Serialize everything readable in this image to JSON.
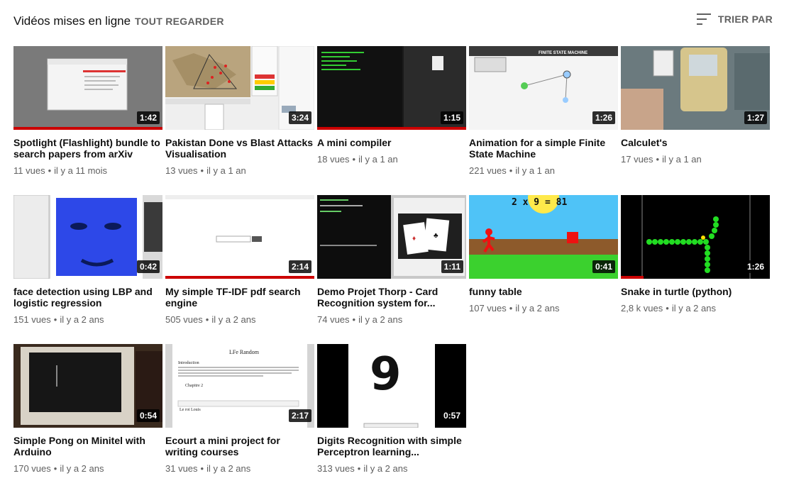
{
  "header": {
    "title": "Vidéos mises en ligne",
    "watch_all": "TOUT REGARDER",
    "sort": {
      "label": "TRIER PAR",
      "icon": "sort-icon"
    }
  },
  "videos": [
    {
      "title": "Spotlight (Flashlight) bundle to search papers from arXiv",
      "duration": "1:42",
      "views": "11 vues",
      "age": "il y a 11 mois",
      "watched": 1.0
    },
    {
      "title": "Pakistan Done vs Blast Attacks Visualisation",
      "duration": "3:24",
      "views": "13 vues",
      "age": "il y a 1 an",
      "watched": 0
    },
    {
      "title": "A mini compiler",
      "duration": "1:15",
      "views": "18 vues",
      "age": "il y a 1 an",
      "watched": 1.0
    },
    {
      "title": "Animation for a simple Finite State Machine",
      "duration": "1:26",
      "views": "221 vues",
      "age": "il y a 1 an",
      "watched": 0
    },
    {
      "title": "Calculet's",
      "duration": "1:27",
      "views": "17 vues",
      "age": "il y a 1 an",
      "watched": 0
    },
    {
      "title": "face detection using LBP and logistic regression",
      "duration": "0:42",
      "views": "151 vues",
      "age": "il y a 2 ans",
      "watched": 0
    },
    {
      "title": "My simple TF-IDF pdf search engine",
      "duration": "2:14",
      "views": "505 vues",
      "age": "il y a 2 ans",
      "watched": 1.0
    },
    {
      "title": "Demo Projet Thorp - Card Recognition system for...",
      "duration": "1:11",
      "views": "74 vues",
      "age": "il y a 2 ans",
      "watched": 0
    },
    {
      "title": "funny table",
      "duration": "0:41",
      "views": "107 vues",
      "age": "il y a 2 ans",
      "watched": 0
    },
    {
      "title": "Snake in turtle (python)",
      "duration": "1:26",
      "views": "2,8 k vues",
      "age": "il y a 2 ans",
      "watched": 0.15
    },
    {
      "title": "Simple Pong on Minitel with Arduino",
      "duration": "0:54",
      "views": "170 vues",
      "age": "il y a 2 ans",
      "watched": 0
    },
    {
      "title": "Ecourt a mini project for writing courses",
      "duration": "2:17",
      "views": "31 vues",
      "age": "il y a 2 ans",
      "watched": 0
    },
    {
      "title": "Digits Recognition with simple Perceptron learning...",
      "duration": "0:57",
      "views": "313 vues",
      "age": "il y a 2 ans",
      "watched": 0
    }
  ],
  "thumb_texts": {
    "fsm_title": "FINITE STATE MACHINE",
    "funny_table_eq": "2 x 9 = 81",
    "lfe_title": "LFe Random",
    "lfe_intro": "Introduction",
    "lfe_ch2": "Chapitre 2",
    "lfe_roi": "Le roi Louis",
    "digit": "9"
  },
  "colors": {
    "accent": "#cc0000",
    "meta": "#606060"
  }
}
